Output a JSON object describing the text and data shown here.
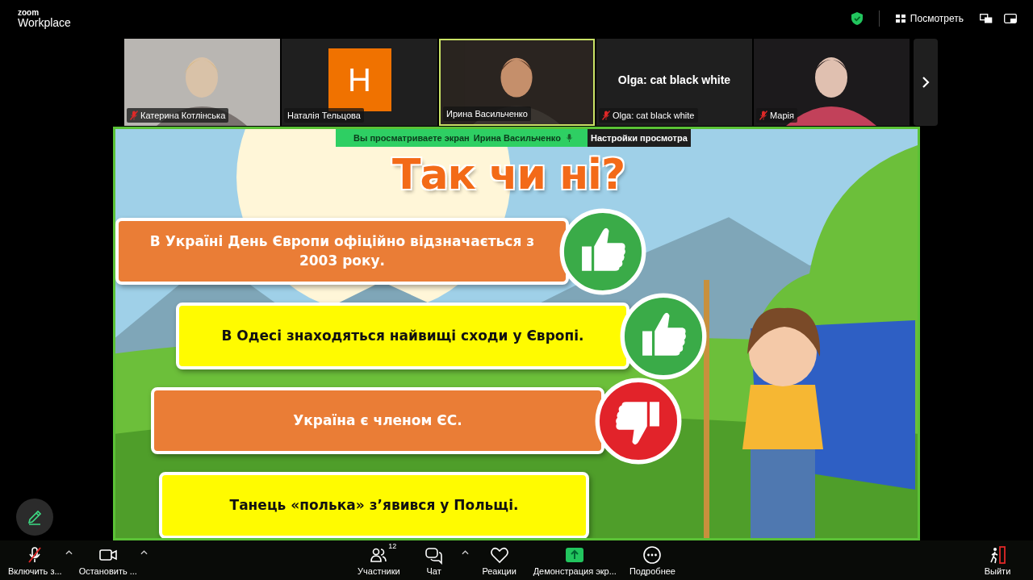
{
  "app": {
    "logo_top": "zoom",
    "logo_bottom": "Workplace"
  },
  "top_bar": {
    "view_button": "Посмотреть"
  },
  "participants": [
    {
      "kind": "video",
      "name": "Катерина Котлінська",
      "muted": true,
      "speaking": false
    },
    {
      "kind": "avatar",
      "initial": "H",
      "name": "Наталія Тельцова",
      "muted": false,
      "speaking": false
    },
    {
      "kind": "video",
      "name": "Ирина Васильченко",
      "muted": false,
      "speaking": true
    },
    {
      "kind": "text",
      "display_text": "Olga: cat black white",
      "name": "Olga: cat black white",
      "muted": true,
      "speaking": false
    },
    {
      "kind": "video",
      "name": "Марія",
      "muted": true,
      "speaking": false
    }
  ],
  "share_banner": {
    "text": "Вы просматриваете экран",
    "presenter": "Ирина Васильченко",
    "settings_button": "Настройки просмотра"
  },
  "slide": {
    "title": "Так чи ні?",
    "statements": [
      {
        "text": "В Україні День Європи офіційно відзначається з 2003 року.",
        "color": "#ea7d36",
        "kind": "thumbs-up"
      },
      {
        "text": "В Одесі знаходяться найвищі сходи у Європі.",
        "color": "#fffb00",
        "kind": "thumbs-up"
      },
      {
        "text": "Україна є членом ЄС.",
        "color": "#ea7d36",
        "kind": "thumbs-down"
      },
      {
        "text": "Танець «полька» з’явився у Польщі.",
        "color": "#fffb00",
        "kind": "plain"
      }
    ]
  },
  "toolbar": [
    {
      "kind": "mic",
      "label": "Включить з...",
      "muted": true,
      "caret": true
    },
    {
      "kind": "video",
      "label": "Остановить ...",
      "caret": true
    },
    {
      "kind": "participants",
      "label": "Участники",
      "count": "12",
      "caret": false
    },
    {
      "kind": "chat",
      "label": "Чат",
      "caret": true
    },
    {
      "kind": "reactions",
      "label": "Реакции",
      "caret": false
    },
    {
      "kind": "share",
      "label": "Демонстрация экр...",
      "caret": false
    },
    {
      "kind": "more",
      "label": "Подробнее",
      "caret": false
    },
    {
      "kind": "leave",
      "label": "Выйти",
      "caret": false
    }
  ]
}
